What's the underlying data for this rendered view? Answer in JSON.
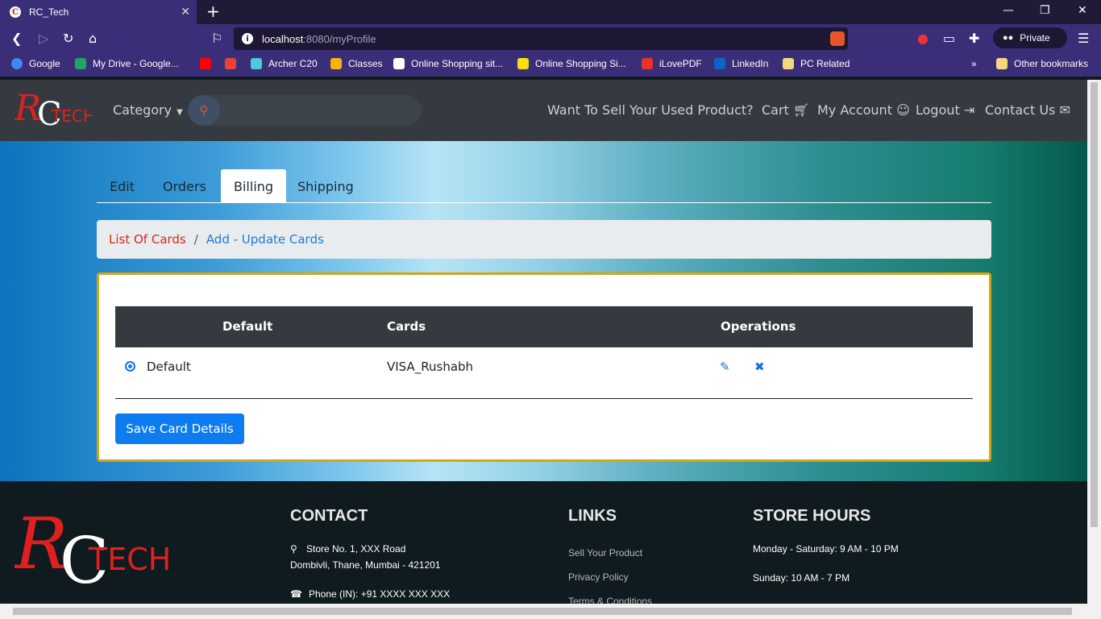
{
  "browser": {
    "tab_title": "RC_Tech",
    "url_host": "localhost",
    "url_path": ":8080/myProfile",
    "shield_count": "2",
    "private_label": "Private",
    "bookmarks": [
      {
        "label": "Google",
        "icon": "google-icon",
        "color": "#4285f4"
      },
      {
        "label": "My Drive - Google...",
        "icon": "drive-icon",
        "color": "#1fa463"
      },
      {
        "label": "",
        "icon": "youtube-icon",
        "color": "#ff0000"
      },
      {
        "label": "",
        "icon": "gmail-icon",
        "color": "#ea4335"
      },
      {
        "label": "Archer C20",
        "icon": "tplink-icon",
        "color": "#4acbd6"
      },
      {
        "label": "Classes",
        "icon": "classroom-icon",
        "color": "#f4b400"
      },
      {
        "label": "Online Shopping sit...",
        "icon": "amazon-icon",
        "color": "#ffffff"
      },
      {
        "label": "Online Shopping Si...",
        "icon": "flipkart-icon",
        "color": "#f7e10a"
      },
      {
        "label": "iLovePDF",
        "icon": "ilovepdf-icon",
        "color": "#e5322d"
      },
      {
        "label": "LinkedIn",
        "icon": "linkedin-icon",
        "color": "#0a66c2"
      },
      {
        "label": "PC Related",
        "icon": "folder-icon",
        "color": "#f6d87c"
      }
    ],
    "more_label": "»",
    "other_bookmarks": "Other bookmarks"
  },
  "navbar": {
    "category": "Category",
    "links": [
      "Want To Sell Your Used Product?",
      "Cart",
      "My Account",
      "Logout",
      "Contact Us"
    ]
  },
  "tabs": [
    "Edit",
    "Orders",
    "Billing",
    "Shipping"
  ],
  "active_tab": "Billing",
  "breadcrumb": {
    "item1": "List Of Cards",
    "separator": "/",
    "item2": "Add - Update Cards"
  },
  "table": {
    "headers": [
      "Default",
      "Cards",
      "Operations"
    ],
    "rows": [
      {
        "default_label": "Default",
        "card": "VISA_Rushabh"
      }
    ]
  },
  "save_button": "Save Card Details",
  "footer": {
    "contact_title": "CONTACT",
    "address_line1": "Store No. 1, XXX Road",
    "address_line2": "Dombivli, Thane, Mumbai - 421201",
    "phone": "Phone (IN): +91 XXXX XXX XXX",
    "links_title": "LINKS",
    "links": [
      "Sell Your Product",
      "Privacy Policy",
      "Terms & Conditions"
    ],
    "hours_title": "STORE HOURS",
    "hours": [
      "Monday - Saturday: 9 AM - 10 PM",
      "Sunday: 10 AM - 7 PM"
    ]
  },
  "colors": {
    "brand_red": "#d9261c",
    "link_blue": "#1e7ad9",
    "card_border": "#d4a514",
    "navbar_bg": "#343a40",
    "primary_button": "#0d7cf0"
  }
}
